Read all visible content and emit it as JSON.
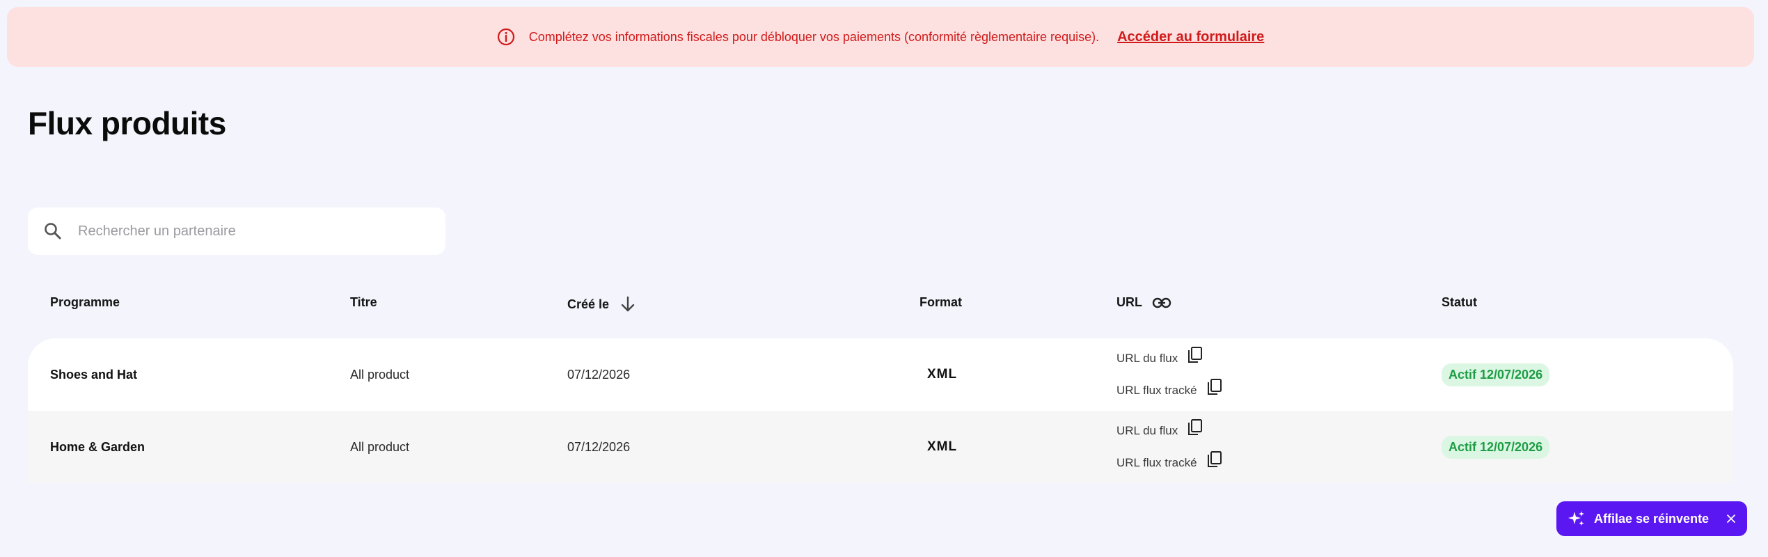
{
  "banner": {
    "icon": "info-circle-icon",
    "message": "Complétez vos informations fiscales pour débloquer vos paiements (conformité règlementaire requise).",
    "link_label": "Accéder au formulaire",
    "background": "#fde0e0",
    "text_color": "#d11a1a"
  },
  "page": {
    "title": "Flux produits"
  },
  "search": {
    "icon": "search-icon",
    "placeholder": "Rechercher un partenaire",
    "value": ""
  },
  "table": {
    "columns": {
      "programme": "Programme",
      "titre": "Titre",
      "cree_le": "Créé le",
      "format": "Format",
      "url": "URL",
      "statut": "Statut"
    },
    "sort": {
      "column": "cree_le",
      "direction": "descending",
      "icon": "arrow-down-icon"
    },
    "url_header_icon": "link-icon",
    "rows": [
      {
        "programme": "Shoes and Hat",
        "titre": "All product",
        "cree_le": "07/12/2026",
        "format": "XML",
        "url_flux_label": "URL du flux",
        "url_tracke_label": "URL flux tracké",
        "statut": "Actif 12/07/2026"
      },
      {
        "programme": "Home & Garden",
        "titre": "All product",
        "cree_le": "07/12/2026",
        "format": "XML",
        "url_flux_label": "URL du flux",
        "url_tracke_label": "URL flux tracké",
        "statut": "Actif 12/07/2026"
      }
    ]
  },
  "promo": {
    "label": "Affilae se réinvente",
    "icon": "sparkle-icon",
    "close_icon": "close-icon",
    "background": "#5b17f2"
  },
  "colors": {
    "page_background": "#f4f5fc",
    "status_active_bg": "#dcf6e4",
    "status_active_text": "#1e9c44"
  }
}
